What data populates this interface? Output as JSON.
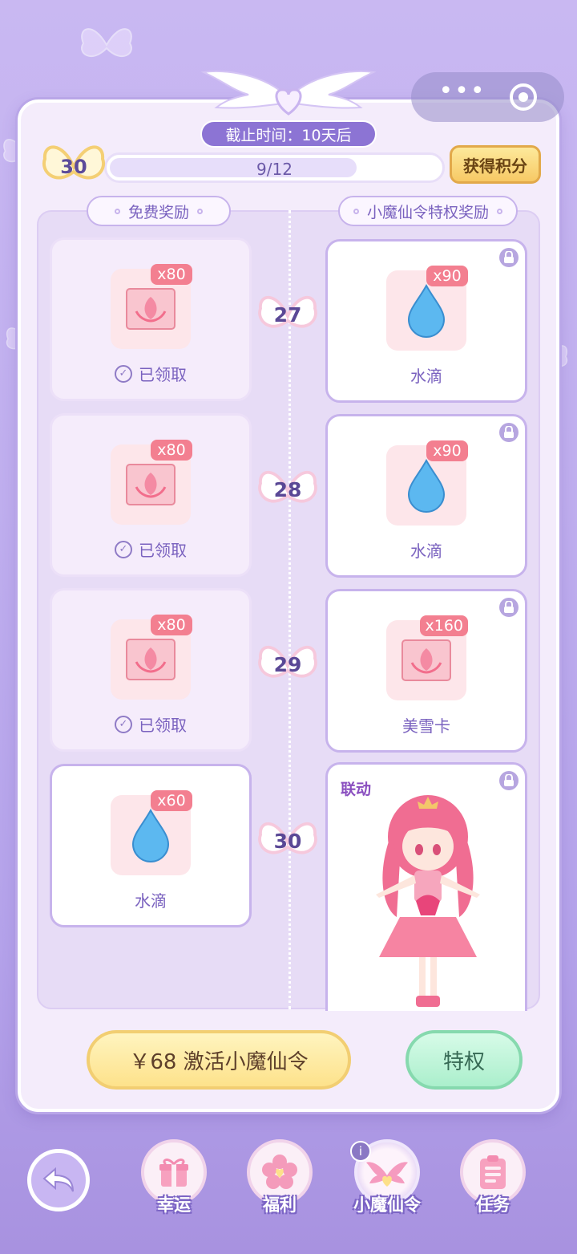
{
  "header": {
    "deadline": "截止时间：10天后",
    "current_level": "30",
    "progress_text": "9/12",
    "progress_fraction": 0.75,
    "earn_button": "获得积分"
  },
  "columns": {
    "free": "免费奖励",
    "vip": "小魔仙令特权奖励"
  },
  "rows": [
    {
      "level": "27",
      "free": {
        "qty": "x80",
        "item": "lotus",
        "status": "已领取"
      },
      "vip": {
        "qty": "x90",
        "item": "drop",
        "label": "水滴"
      }
    },
    {
      "level": "28",
      "free": {
        "qty": "x80",
        "item": "lotus",
        "status": "已领取"
      },
      "vip": {
        "qty": "x90",
        "item": "drop",
        "label": "水滴"
      }
    },
    {
      "level": "29",
      "free": {
        "qty": "x80",
        "item": "lotus",
        "status": "已领取"
      },
      "vip": {
        "qty": "x160",
        "item": "lotus",
        "label": "美雪卡"
      }
    },
    {
      "level": "30",
      "free": {
        "qty": "x60",
        "item": "drop",
        "label": "水滴"
      },
      "vip": {
        "tag": "联动",
        "item": "character"
      }
    }
  ],
  "actions": {
    "buy": "￥68 激活小魔仙令",
    "privilege": "特权"
  },
  "nav": {
    "items": [
      {
        "label": "幸运",
        "icon": "gift-icon"
      },
      {
        "label": "福利",
        "icon": "flower-icon"
      },
      {
        "label": "小魔仙令",
        "icon": "wings-icon"
      },
      {
        "label": "任务",
        "icon": "clipboard-icon"
      }
    ],
    "info_badge": "i"
  },
  "colors": {
    "accent": "#8c74d4",
    "quantity_badge": "#f37f90",
    "gold": "#f7c965",
    "mint": "#abefcc"
  }
}
